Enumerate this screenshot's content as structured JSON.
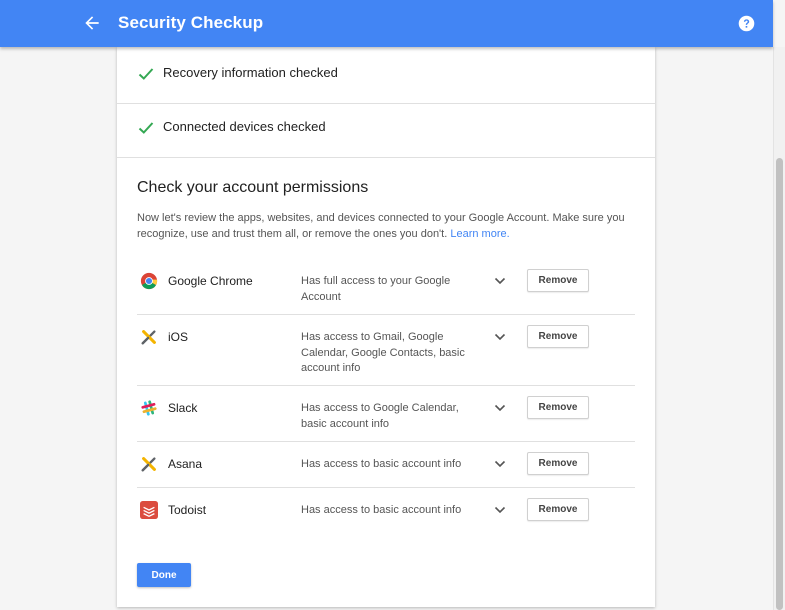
{
  "header": {
    "title": "Security Checkup",
    "back_icon": "arrow-left-icon",
    "help_icon": "help-circle-icon",
    "background": "#4285f4"
  },
  "checks": [
    {
      "label": "Recovery information checked",
      "icon": "checkmark-icon"
    },
    {
      "label": "Connected devices checked",
      "icon": "checkmark-icon"
    }
  ],
  "permissions_section": {
    "title": "Check your account permissions",
    "description": "Now let's review the apps, websites, and devices connected to your Google Account. Make sure you recognize, use and trust them all, or remove the ones you don't.",
    "learn_more": "Learn more.",
    "apps": [
      {
        "name": "Google Chrome",
        "access": "Has full access to your Google Account",
        "icon": "chrome-icon",
        "remove_label": "Remove"
      },
      {
        "name": "iOS",
        "access": "Has access to Gmail, Google Calendar, Google Contacts, basic account info",
        "icon": "ios-app-icon",
        "remove_label": "Remove"
      },
      {
        "name": "Slack",
        "access": "Has access to Google Calendar, basic account info",
        "icon": "slack-icon",
        "remove_label": "Remove"
      },
      {
        "name": "Asana",
        "access": "Has access to basic account info",
        "icon": "asana-app-icon",
        "remove_label": "Remove"
      },
      {
        "name": "Todoist",
        "access": "Has access to basic account info",
        "icon": "todoist-icon",
        "remove_label": "Remove"
      }
    ]
  },
  "done_label": "Done",
  "colors": {
    "accent": "#4285f4",
    "check": "#34a853"
  }
}
